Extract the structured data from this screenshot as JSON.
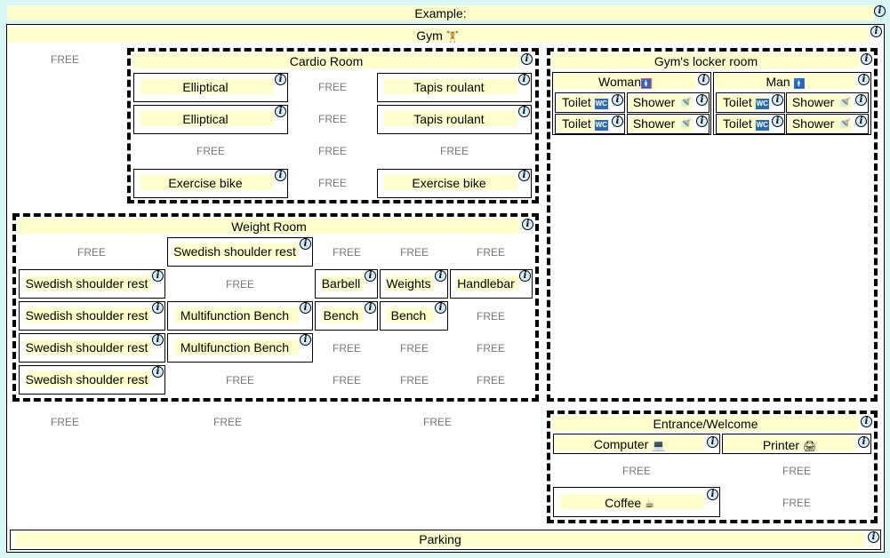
{
  "free_label": "FREE",
  "example": {
    "title": "Example:"
  },
  "gym": {
    "title": "Gym",
    "icon": "weightlifter-icon"
  },
  "cardio": {
    "title": "Cardio Room",
    "items": [
      "Elliptical",
      "Tapis roulant",
      "Elliptical",
      "Tapis roulant",
      "Exercise bike",
      "Exercise bike"
    ]
  },
  "locker": {
    "title": "Gym's locker room",
    "woman": "Woman",
    "man": "Man",
    "toilet": "Toilet",
    "shower": "Shower",
    "wc_badge": "WC"
  },
  "weight": {
    "title": "Weight Room",
    "items": [
      "Swedish shoulder rest",
      "Swedish shoulder rest",
      "Barbell",
      "Weights",
      "Handlebar",
      "Swedish shoulder rest",
      "Multifunction Bench",
      "Bench",
      "Bench",
      "Swedish shoulder rest",
      "Multifunction Bench",
      "Swedish shoulder rest"
    ]
  },
  "entrance": {
    "title": "Entrance/Welcome",
    "computer": "Computer",
    "printer": "Printer",
    "coffee": "Coffee"
  },
  "parking": {
    "title": "Parking"
  },
  "colors": {
    "background": "#d8f6f6",
    "header": "#ffffcc",
    "info": "#cfeefd"
  }
}
